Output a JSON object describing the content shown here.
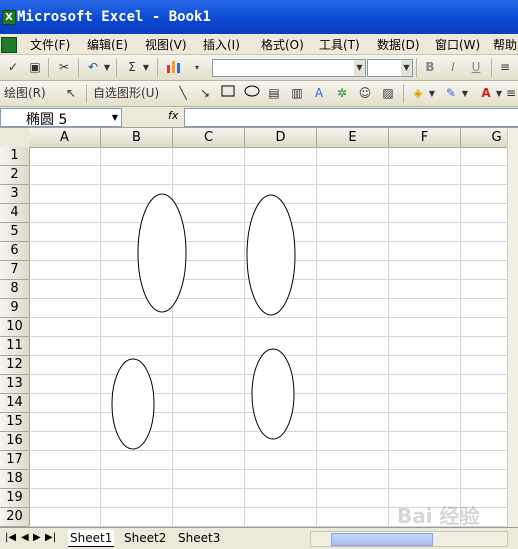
{
  "window": {
    "title": "Microsoft Excel - Book1"
  },
  "menu": [
    "文件(F)",
    "编辑(E)",
    "视图(V)",
    "插入(I)",
    "格式(O)",
    "工具(T)",
    "数据(D)",
    "窗口(W)",
    "帮助"
  ],
  "drawing_toolbar": {
    "draw_label": "绘图(R)",
    "autoshapes_label": "自选图形(U)"
  },
  "formula_bar": {
    "name_box": "椭圆 5",
    "fx_label": "fx"
  },
  "columns": [
    "A",
    "B",
    "C",
    "D",
    "E",
    "F",
    "G"
  ],
  "rows": [
    "1",
    "2",
    "3",
    "4",
    "5",
    "6",
    "7",
    "8",
    "9",
    "10",
    "11",
    "12",
    "13",
    "14",
    "15",
    "16",
    "17",
    "18",
    "19",
    "20"
  ],
  "sheets": [
    "Sheet1",
    "Sheet2",
    "Sheet3"
  ],
  "active_sheet": "Sheet1",
  "watermark": "Bai 经验",
  "colors": {
    "title_bar": "#0a46d0",
    "chrome": "#ece9d8",
    "gridline": "#d4d4d4"
  }
}
